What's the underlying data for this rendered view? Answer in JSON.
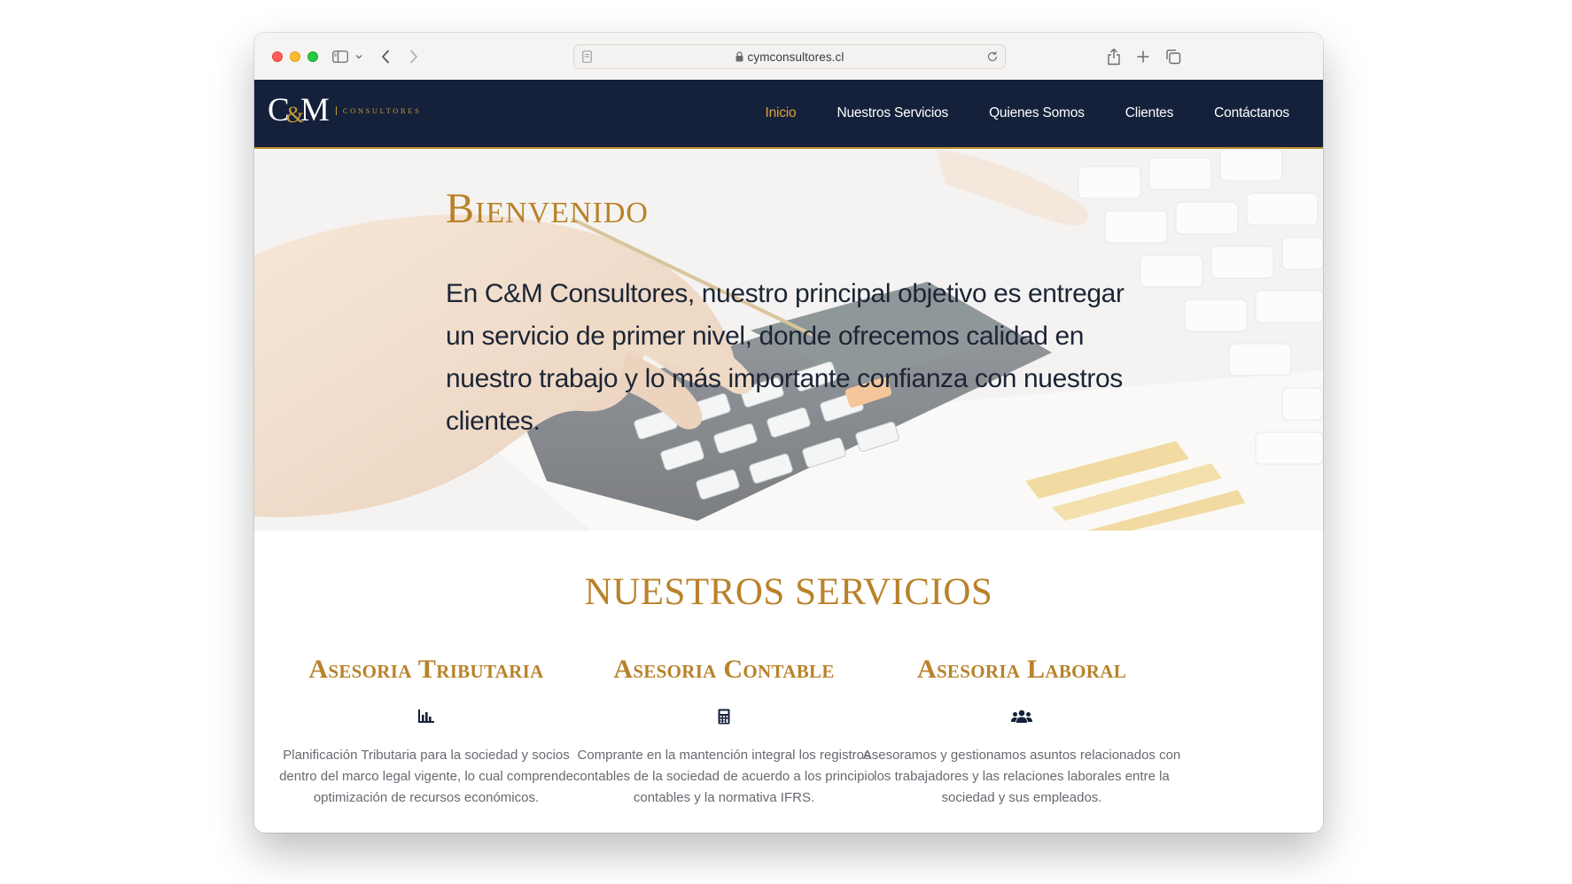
{
  "browser": {
    "url": "cymconsultores.cl"
  },
  "site": {
    "logo": {
      "left": "C",
      "amp": "&",
      "right": "M",
      "sub": "CONSULTORES"
    },
    "nav": [
      {
        "label": "Inicio",
        "active": true
      },
      {
        "label": "Nuestros Servicios",
        "active": false
      },
      {
        "label": "Quienes Somos",
        "active": false
      },
      {
        "label": "Clientes",
        "active": false
      },
      {
        "label": "Contáctanos",
        "active": false
      }
    ],
    "colors": {
      "nav_bg": "#15213a",
      "accent_gold": "#b9822a",
      "active_link": "#d9a23a"
    }
  },
  "hero": {
    "title": "Bienvenido",
    "text": "En C&M Consultores, nuestro principal objetivo es entregar un servicio de primer nivel, donde ofrecemos calidad en nuestro trabajo y lo más importante confianza con nuestros clientes."
  },
  "services": {
    "title": "NUESTROS SERVICIOS",
    "items": [
      {
        "title": "Asesoria Tributaria",
        "icon": "bar-chart-icon",
        "description": "Planificación Tributaria para la sociedad y socios dentro del marco legal vigente, lo cual comprende optimización de recursos económicos."
      },
      {
        "title": "Asesoria Contable",
        "icon": "calculator-icon",
        "description": "Comprante en la mantención integral los registros contables de la sociedad de acuerdo a los principio contables y la normativa IFRS."
      },
      {
        "title": "Asesoria Laboral",
        "icon": "users-icon",
        "description": "Asesoramos y gestionamos asuntos relacionados con los trabajadores y las relaciones laborales entre la sociedad y sus empleados."
      }
    ]
  }
}
